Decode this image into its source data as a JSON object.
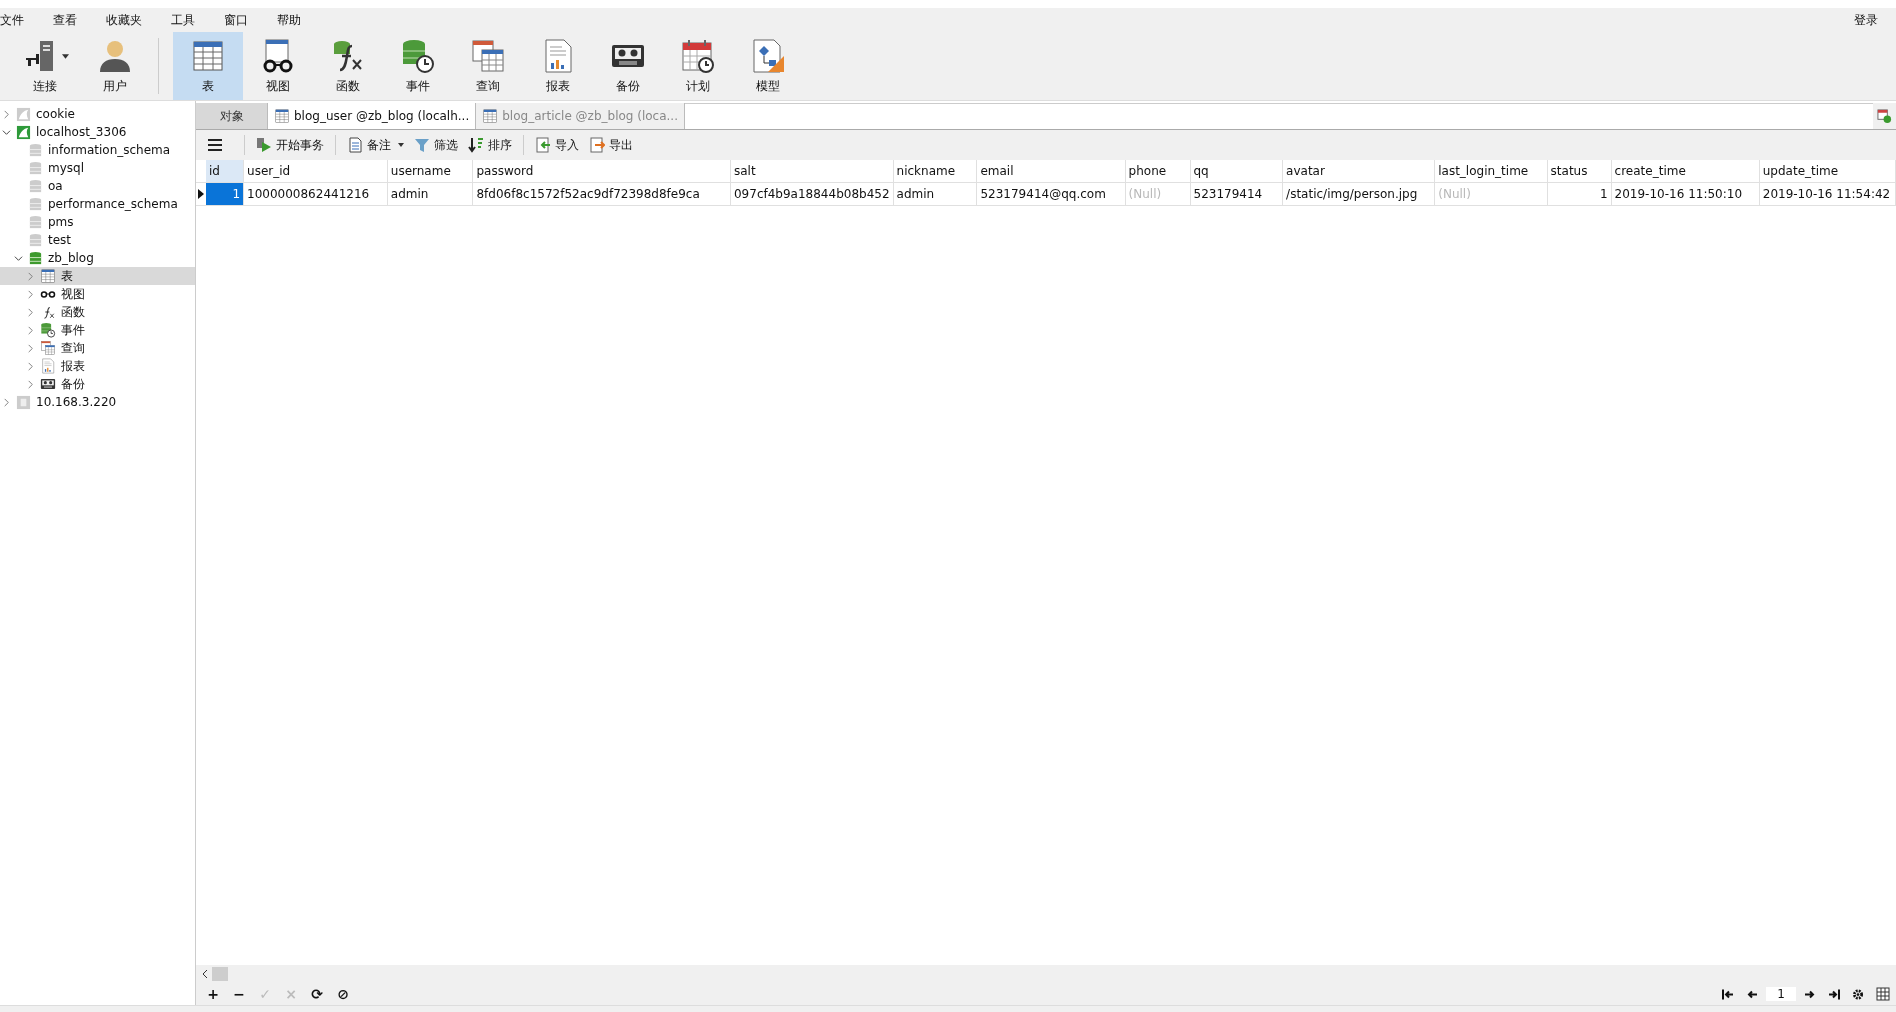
{
  "menu": [
    "文件",
    "查看",
    "收藏夹",
    "工具",
    "窗口",
    "帮助"
  ],
  "login": "登录",
  "toolbar": [
    {
      "kind": "connect",
      "label": "连接",
      "dropdown": true,
      "selected": false
    },
    {
      "kind": "user",
      "label": "用户",
      "dropdown": false,
      "selected": false
    },
    {
      "kind": "table",
      "label": "表",
      "dropdown": false,
      "selected": true
    },
    {
      "kind": "view",
      "label": "视图",
      "dropdown": false,
      "selected": false
    },
    {
      "kind": "function",
      "label": "函数",
      "dropdown": false,
      "selected": false
    },
    {
      "kind": "event",
      "label": "事件",
      "dropdown": false,
      "selected": false
    },
    {
      "kind": "query",
      "label": "查询",
      "dropdown": false,
      "selected": false
    },
    {
      "kind": "report",
      "label": "报表",
      "dropdown": false,
      "selected": false
    },
    {
      "kind": "backup",
      "label": "备份",
      "dropdown": false,
      "selected": false
    },
    {
      "kind": "schedule",
      "label": "计划",
      "dropdown": false,
      "selected": false
    },
    {
      "kind": "model",
      "label": "模型",
      "dropdown": false,
      "selected": false
    }
  ],
  "sidebar": [
    {
      "kind": "connection",
      "label": "cookie",
      "expanded": false,
      "selected": false,
      "active": false
    },
    {
      "kind": "connection",
      "label": "localhost_3306",
      "expanded": true,
      "selected": false,
      "active": true,
      "children": [
        {
          "kind": "database",
          "label": "information_schema",
          "selected": false,
          "active": false
        },
        {
          "kind": "database",
          "label": "mysql",
          "selected": false,
          "active": false
        },
        {
          "kind": "database",
          "label": "oa",
          "selected": false,
          "active": false
        },
        {
          "kind": "database",
          "label": "performance_schema",
          "selected": false,
          "active": false
        },
        {
          "kind": "database",
          "label": "pms",
          "selected": false,
          "active": false
        },
        {
          "kind": "database",
          "label": "test",
          "selected": false,
          "active": false
        },
        {
          "kind": "database",
          "label": "zb_blog",
          "expanded": true,
          "selected": false,
          "active": true,
          "children": [
            {
              "kind": "table",
              "label": "表",
              "expanded": false,
              "selected": true
            },
            {
              "kind": "view",
              "label": "视图",
              "expanded": false,
              "selected": false
            },
            {
              "kind": "function",
              "label": "函数",
              "expanded": false,
              "selected": false
            },
            {
              "kind": "event",
              "label": "事件",
              "expanded": false,
              "selected": false
            },
            {
              "kind": "query",
              "label": "查询",
              "expanded": false,
              "selected": false
            },
            {
              "kind": "report",
              "label": "报表",
              "expanded": false,
              "selected": false
            },
            {
              "kind": "backup",
              "label": "备份",
              "expanded": false,
              "selected": false
            }
          ]
        }
      ]
    },
    {
      "kind": "remote",
      "label": "10.168.3.220",
      "expanded": false,
      "selected": false
    }
  ],
  "tabs": [
    {
      "kind": "objects",
      "label": "对象",
      "selected": false
    },
    {
      "kind": "table",
      "label": "blog_user @zb_blog (localh...",
      "selected": true
    },
    {
      "kind": "table",
      "label": "blog_article @zb_blog (loca...",
      "selected": false
    }
  ],
  "actions": [
    {
      "kind": "transaction",
      "label": "开始事务",
      "dropdown": false
    },
    {
      "kind": "note",
      "label": "备注",
      "dropdown": true
    },
    {
      "kind": "filter",
      "label": "筛选",
      "dropdown": false
    },
    {
      "kind": "sort",
      "label": "排序",
      "dropdown": false
    },
    {
      "kind": "import",
      "label": "导入",
      "dropdown": false
    },
    {
      "kind": "export",
      "label": "导出",
      "dropdown": false
    }
  ],
  "table": {
    "columns": [
      {
        "name": "id",
        "kind": "number",
        "selected": true
      },
      {
        "name": "user_id",
        "kind": "text",
        "selected": false
      },
      {
        "name": "username",
        "kind": "text",
        "selected": false
      },
      {
        "name": "password",
        "kind": "text",
        "selected": false
      },
      {
        "name": "salt",
        "kind": "text",
        "selected": false
      },
      {
        "name": "nickname",
        "kind": "text",
        "selected": false
      },
      {
        "name": "email",
        "kind": "text",
        "selected": false
      },
      {
        "name": "phone",
        "kind": "text",
        "selected": false
      },
      {
        "name": "qq",
        "kind": "text",
        "selected": false
      },
      {
        "name": "avatar",
        "kind": "text",
        "selected": false
      },
      {
        "name": "last_login_time",
        "kind": "text",
        "selected": false
      },
      {
        "name": "status",
        "kind": "number",
        "selected": false
      },
      {
        "name": "create_time",
        "kind": "text",
        "selected": false
      },
      {
        "name": "update_time",
        "kind": "text",
        "selected": false
      }
    ],
    "rows": [
      {
        "selected": true,
        "cells": [
          {
            "text": "1",
            "null": false,
            "selected": true
          },
          {
            "text": "1000000862441216",
            "null": false,
            "selected": false
          },
          {
            "text": "admin",
            "null": false,
            "selected": false
          },
          {
            "text": "8fd06f8c1572f52ac9df72398d8fe9ca",
            "null": false,
            "selected": false
          },
          {
            "text": "097cf4b9a18844b08b452",
            "null": false,
            "selected": false
          },
          {
            "text": "admin",
            "null": false,
            "selected": false
          },
          {
            "text": "523179414@qq.com",
            "null": false,
            "selected": false
          },
          {
            "text": "(Null)",
            "null": true,
            "selected": false
          },
          {
            "text": "523179414",
            "null": false,
            "selected": false
          },
          {
            "text": "/static/img/person.jpg",
            "null": false,
            "selected": false
          },
          {
            "text": "(Null)",
            "null": true,
            "selected": false
          },
          {
            "text": "1",
            "null": false,
            "selected": false
          },
          {
            "text": "2019-10-16 11:50:10",
            "null": false,
            "selected": false
          },
          {
            "text": "2019-10-16 11:54:42",
            "null": false,
            "selected": false
          }
        ]
      }
    ]
  },
  "record_buttons": [
    {
      "label": "+",
      "disabled": false
    },
    {
      "label": "−",
      "disabled": false
    },
    {
      "label": "✓",
      "disabled": true
    },
    {
      "label": "×",
      "disabled": true
    },
    {
      "label": "⟳",
      "disabled": false
    },
    {
      "label": "⊘",
      "disabled": false
    }
  ],
  "pager": {
    "page": "1"
  }
}
